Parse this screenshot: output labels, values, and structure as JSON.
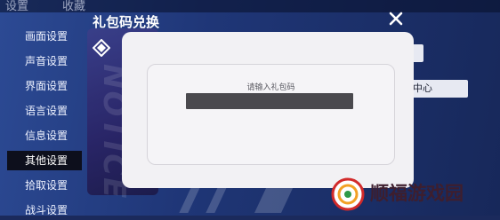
{
  "header": {
    "left_text": "设置",
    "mid_text": "收藏"
  },
  "sidebar": {
    "items": [
      {
        "label": "画面设置",
        "active": false
      },
      {
        "label": "声音设置",
        "active": false
      },
      {
        "label": "界面设置",
        "active": false
      },
      {
        "label": "语言设置",
        "active": false
      },
      {
        "label": "信息设置",
        "active": false
      },
      {
        "label": "其他设置",
        "active": true
      },
      {
        "label": "拾取设置",
        "active": false
      },
      {
        "label": "战斗设置",
        "active": false
      }
    ]
  },
  "background_panel": {
    "watermark": "NOTICE",
    "chip_right": "中心"
  },
  "dialog": {
    "title": "礼包码兑换",
    "prompt": "请输入礼包码",
    "input_value": "",
    "close_icon": "close-icon"
  },
  "watermark": {
    "text": "顺福游戏园",
    "accent": "#d22a2a"
  }
}
